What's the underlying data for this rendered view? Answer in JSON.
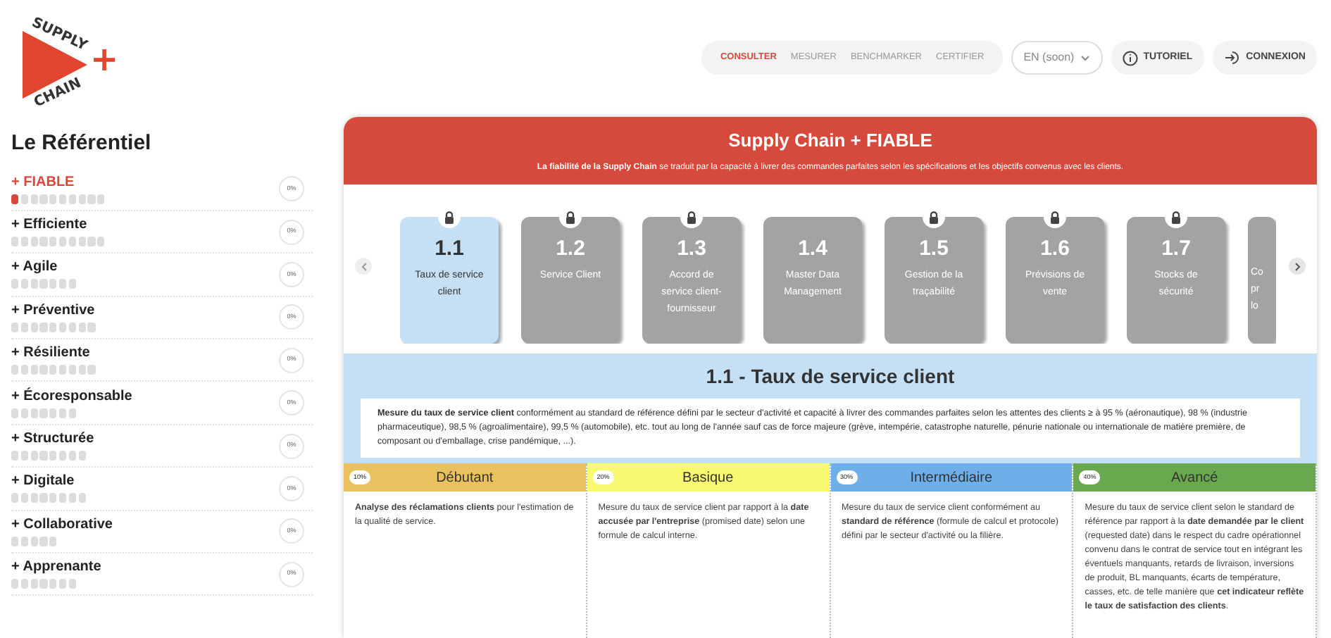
{
  "logo": {
    "top": "SUPPLY",
    "bottom": "CHAIN",
    "mark": "+"
  },
  "nav": {
    "tabs": [
      {
        "label": "CONSULTER",
        "selected": true
      },
      {
        "label": "MESURER",
        "selected": false
      },
      {
        "label": "BENCHMARKER",
        "selected": false
      },
      {
        "label": "CERTIFIER",
        "selected": false
      }
    ],
    "language": "EN (soon)",
    "tutorial": "TUTORIEL",
    "login": "CONNEXION"
  },
  "sidebar": {
    "title": "Le Référentiel",
    "items": [
      {
        "label": "+ FIABLE",
        "selected": true,
        "percent": "0%",
        "steps": [
          true,
          false,
          false,
          false,
          false,
          false,
          false,
          false,
          false,
          false
        ]
      },
      {
        "label": "+ Efficiente",
        "selected": false,
        "percent": "0%",
        "steps": [
          false,
          false,
          false,
          false,
          false,
          false,
          false,
          false,
          false,
          false
        ]
      },
      {
        "label": "+ Agile",
        "selected": false,
        "percent": "0%",
        "steps": [
          false,
          false,
          false,
          false,
          false,
          false,
          false
        ]
      },
      {
        "label": "+ Préventive",
        "selected": false,
        "percent": "0%",
        "steps": [
          false,
          false,
          false,
          false,
          false,
          false,
          false,
          false,
          false
        ]
      },
      {
        "label": "+ Résiliente",
        "selected": false,
        "percent": "0%",
        "steps": [
          false,
          false,
          false,
          false,
          false,
          false,
          false,
          false,
          false
        ]
      },
      {
        "label": "+ Écoresponsable",
        "selected": false,
        "percent": "0%",
        "steps": [
          false,
          false,
          false,
          false,
          false,
          false,
          false
        ]
      },
      {
        "label": "+ Structurée",
        "selected": false,
        "percent": "0%",
        "steps": [
          false,
          false,
          false,
          false,
          false,
          false,
          false,
          false
        ]
      },
      {
        "label": "+ Digitale",
        "selected": false,
        "percent": "0%",
        "steps": [
          false,
          false,
          false,
          false,
          false,
          false,
          false,
          false
        ]
      },
      {
        "label": "+ Collaborative",
        "selected": false,
        "percent": "0%",
        "steps": [
          false,
          false,
          false,
          false,
          false
        ]
      },
      {
        "label": "+ Apprenante",
        "selected": false,
        "percent": "0%",
        "steps": [
          false,
          false,
          false,
          false,
          false,
          false,
          false
        ]
      }
    ]
  },
  "header": {
    "title": "Supply Chain + FIABLE",
    "subtitle": "**La fiabilité de la Supply Chain** se traduit par la capacité à livrer des commandes parfaites selon les spécifications et les objectifs convenus avec les clients."
  },
  "cards": [
    {
      "number": "1.1",
      "label": "Taux de service\nclient",
      "selected": true,
      "locked": true
    },
    {
      "number": "1.2",
      "label": "Service Client",
      "selected": false,
      "locked": true
    },
    {
      "number": "1.3",
      "label": "Accord de\nservice client-\nfournisseur",
      "selected": false,
      "locked": true
    },
    {
      "number": "1.4",
      "label": "Master Data\nManagement",
      "selected": false,
      "locked": false
    },
    {
      "number": "1.5",
      "label": "Gestion de la\ntraçabilité",
      "selected": false,
      "locked": true
    },
    {
      "number": "1.6",
      "label": "Prévisions de\nvente",
      "selected": false,
      "locked": true
    },
    {
      "number": "1.7",
      "label": "Stocks de\nsécurité",
      "selected": false,
      "locked": true
    },
    {
      "label": "Co\npr\nlo",
      "selected": false,
      "locked": false
    }
  ],
  "detail": {
    "title": "1.1 - Taux de service client",
    "description": "**Mesure du taux de service client** conformément au standard de référence défini par le secteur d'activité et capacité à livrer des commandes parfaites selon les attentes des clients ≥ à 95 % (aéronautique),  98 % (industrie pharmaceutique), 98,5 % (agroalimentaire), 99,5 % (automobile), etc. tout au long de l'année sauf cas de force majeure (grève, intempérie, catastrophe naturelle, pénurie nationale ou internationale de matière première, de composant ou d'emballage, crise pandémique, ...).",
    "levels": [
      {
        "badge": "10%",
        "name": "Débutant",
        "color": "#e9c15f",
        "text": "**Analyse des réclamations clients** pour l'estimation de la qualité de service."
      },
      {
        "badge": "20%",
        "name": "Basique",
        "color": "#f9f871",
        "text": "Mesure du taux de service client par rapport à la **date accusée par l'entreprise** (promised date) selon une formule de calcul interne."
      },
      {
        "badge": "30%",
        "name": "Intermédiaire",
        "color": "#6eaee9",
        "text": "Mesure du taux de service client conformément au **standard de référence** (formule de calcul et protocole) défini par le secteur d'activité ou la filière."
      },
      {
        "badge": "40%",
        "name": "Avancé",
        "color": "#6aa84f",
        "text": "Mesure du taux de service client selon le standard de référence par rapport à la **date demandée par le client** (requested date) dans le respect du cadre opérationnel convenu dans le contrat de service tout en intégrant les éventuels manquants, retards de livraison, inversions de produit, BL manquants, écarts de température, casses, etc. de telle manière que **cet indicateur reflète le taux de satisfaction des clients**."
      }
    ]
  }
}
